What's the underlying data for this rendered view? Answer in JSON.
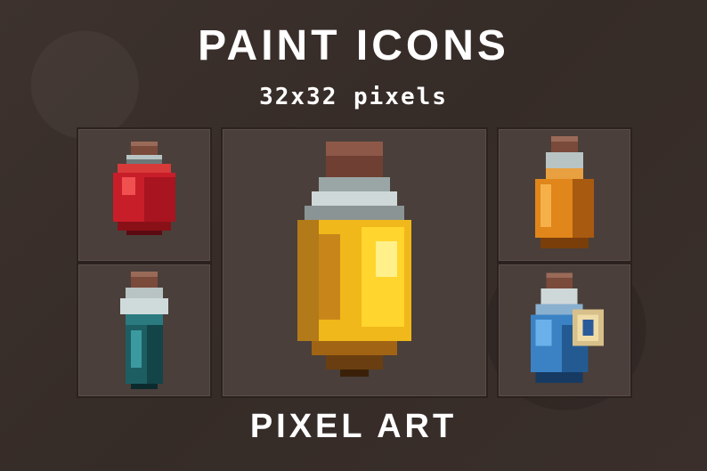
{
  "header": {
    "title": "PAINT ICONS",
    "subtitle": "32x32 pixels"
  },
  "footer": {
    "label": "PIXEL ART"
  },
  "icons": [
    {
      "name": "red-potion-icon",
      "liquid": "#c81e2a"
    },
    {
      "name": "teal-potion-icon",
      "liquid": "#1d5e63"
    },
    {
      "name": "yellow-potion-icon",
      "liquid": "#f0b81a"
    },
    {
      "name": "orange-potion-icon",
      "liquid": "#e0861a"
    },
    {
      "name": "blue-potion-icon",
      "liquid": "#3a82c4"
    }
  ]
}
